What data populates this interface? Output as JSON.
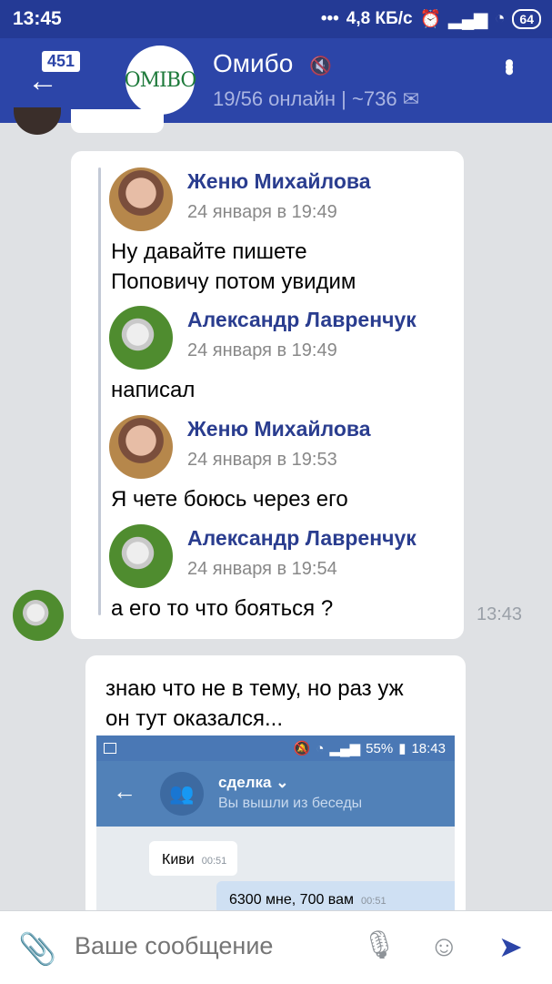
{
  "status_bar": {
    "time": "13:45",
    "network": "4,8 КБ/с",
    "battery": "64"
  },
  "header": {
    "unread_badge": "451",
    "group_avatar_text": "OMIBO",
    "title": "Омибо",
    "subtitle": "19/56 онлайн | ~736"
  },
  "messages": {
    "forwarded": [
      {
        "author": "Женю Михайлова",
        "date": "24 января в 19:49",
        "lines": [
          "Ну давайте пишете",
          "Поповичу потом увидим"
        ]
      },
      {
        "author": "Александр Лавренчук",
        "date": "24 января в 19:49",
        "lines": [
          "написал"
        ]
      },
      {
        "author": "Женю Михайлова",
        "date": "24 января в 19:53",
        "lines": [
          "Я чете боюсь через его"
        ]
      },
      {
        "author": "Александр Лавренчук",
        "date": "24 января в 19:54",
        "lines": [
          "а его то что бояться ?"
        ]
      }
    ],
    "time1": "13:43",
    "second": {
      "line1": "знаю что не в тему, но раз уж",
      "line2": "он тут оказался...",
      "screenshot": {
        "status": "55%",
        "time": "18:43",
        "chat_title": "сделка",
        "chat_subtitle": "Вы вышли из беседы",
        "msg1": "Киви",
        "msg1_time": "00:51",
        "msg2": "6300 мне, 700 вам",
        "msg2_time": "00:51"
      }
    }
  },
  "input": {
    "placeholder": "Ваше сообщение"
  },
  "colors": {
    "header": "#2c45a8",
    "link": "#2a3d8f"
  }
}
